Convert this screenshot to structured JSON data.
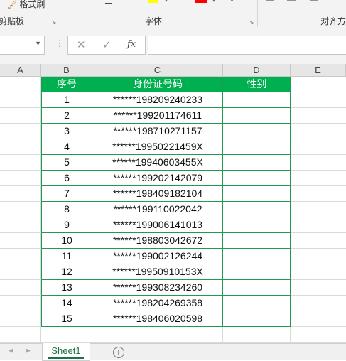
{
  "ribbon": {
    "format_painter_label": "格式刷",
    "clipboard_group_label": "剪贴板",
    "font_group_label": "字体",
    "align_group_label": "对齐方",
    "highlight_color": "#ffff00",
    "font_color": "#ff0000"
  },
  "formula_bar": {
    "name_box_value": "",
    "cancel_icon": "close-icon",
    "enter_icon": "check-icon",
    "fx_label": "fx",
    "formula_value": ""
  },
  "columns": [
    "A",
    "B",
    "C",
    "D",
    "E"
  ],
  "table": {
    "headers": [
      "序号",
      "身份证号码",
      "性别"
    ],
    "header_color": "#00b050",
    "rows": [
      {
        "no": "1",
        "id": "******198209240233",
        "gender": ""
      },
      {
        "no": "2",
        "id": "******199201174611",
        "gender": ""
      },
      {
        "no": "3",
        "id": "******198710271157",
        "gender": ""
      },
      {
        "no": "4",
        "id": "******19950221459X",
        "gender": ""
      },
      {
        "no": "5",
        "id": "******19940603455X",
        "gender": ""
      },
      {
        "no": "6",
        "id": "******199202142079",
        "gender": ""
      },
      {
        "no": "7",
        "id": "******198409182104",
        "gender": ""
      },
      {
        "no": "8",
        "id": "******199110022042",
        "gender": ""
      },
      {
        "no": "9",
        "id": "******199006141013",
        "gender": ""
      },
      {
        "no": "10",
        "id": "******198803042672",
        "gender": ""
      },
      {
        "no": "11",
        "id": "******199002126244",
        "gender": ""
      },
      {
        "no": "12",
        "id": "******19950910153X",
        "gender": ""
      },
      {
        "no": "13",
        "id": "******199308234260",
        "gender": ""
      },
      {
        "no": "14",
        "id": "******198204269358",
        "gender": ""
      },
      {
        "no": "15",
        "id": "******198406020598",
        "gender": ""
      }
    ]
  },
  "sheet_tabs": {
    "active": "Sheet1",
    "add_icon": "plus-circle-icon"
  }
}
